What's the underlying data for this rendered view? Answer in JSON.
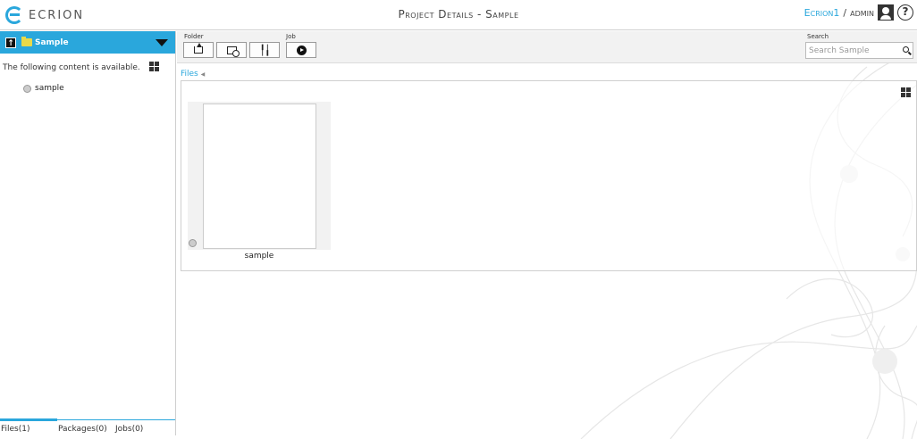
{
  "header": {
    "logo_text": "ECRION",
    "title": "Project Details - Sample",
    "user_link": "Ecrion1",
    "separator": "/",
    "user_name": "admin",
    "help_label": "?"
  },
  "sidebar": {
    "folder_name": "Sample",
    "message": "The following content is available.",
    "items": [
      {
        "label": "sample",
        "icon": "file-icon"
      }
    ],
    "tabs": [
      {
        "label": "Files(1)",
        "active": true
      },
      {
        "label": "Packages(0)",
        "active": false
      },
      {
        "label": "Jobs(0)",
        "active": false
      }
    ]
  },
  "toolbar": {
    "folder_group_label": "Folder",
    "job_group_label": "Job",
    "search_label": "Search",
    "search_placeholder": "Search Sample",
    "buttons": [
      {
        "name": "upload-icon"
      },
      {
        "name": "new-folder-icon"
      },
      {
        "name": "tools-icon"
      },
      {
        "name": "play-icon"
      }
    ]
  },
  "main": {
    "breadcrumb": "Files",
    "files": [
      {
        "label": "sample"
      }
    ]
  },
  "colors": {
    "accent": "#2aa7dc"
  }
}
